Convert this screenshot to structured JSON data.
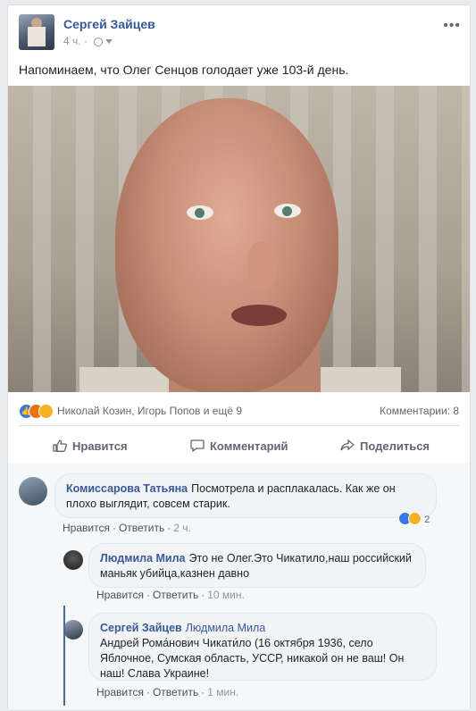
{
  "post": {
    "author": "Сергей Зайцев",
    "time": "4 ч.",
    "more_icon": "ellipsis-icon",
    "text": "Напоминаем, что Олег Сенцов голодает уже 103-й день.",
    "photo_description_icon": "post-photo"
  },
  "reactions": {
    "names": "Николай Козин, Игорь Попов и ещё 9",
    "comments_count": "Комментарии: 8",
    "colors": {
      "like": "#3578e5",
      "angry": "#e9710f",
      "sad": "#f7b125"
    }
  },
  "actions": {
    "like": "Нравится",
    "comment": "Комментарий",
    "share": "Поделиться"
  },
  "comments": [
    {
      "name": "Комиссарова Татьяна",
      "text": "Посмотрела и расплакалась. Как же он плохо выглядит, совсем старик.",
      "like": "Нравится",
      "reply": "Ответить",
      "time": "2 ч.",
      "reactions_count": "2"
    },
    {
      "name": "Людмила Мила",
      "text": "Это не Олег.Это Чикатило,наш российский маньяк убийца,казнен давно",
      "like": "Нравится",
      "reply": "Ответить",
      "time": "10 мин."
    },
    {
      "name": "Сергей Зайцев",
      "mention": "Людмила Мила",
      "text": "Андрей Рома́нович Чикати́ло (16 октября 1936, село Яблочное, Сумская область, УССР, никакой он не ваш! Он наш! Слава Украине!",
      "like": "Нравится",
      "reply": "Ответить",
      "time": "1 мин."
    }
  ],
  "separator": "·"
}
